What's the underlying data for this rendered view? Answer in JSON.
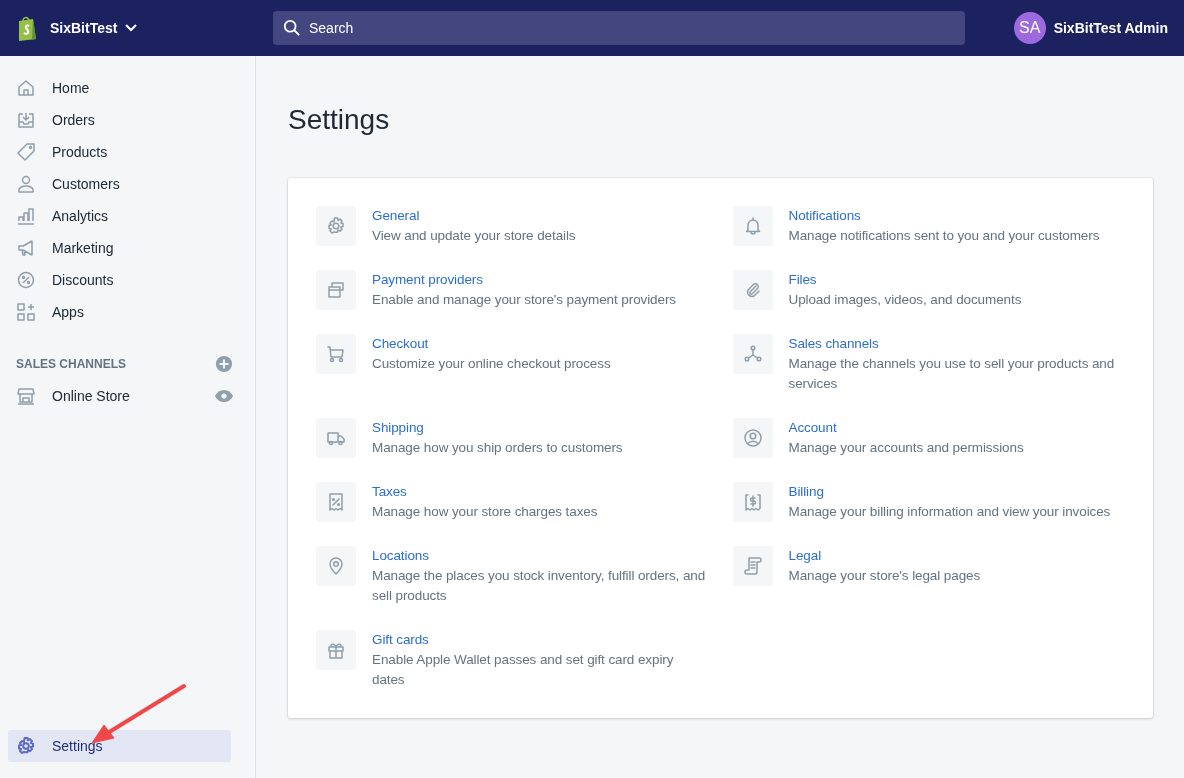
{
  "topbar": {
    "store_name": "SixBitTest",
    "search": {
      "placeholder": "Search"
    },
    "avatar_initials": "SA",
    "user_name": "SixBitTest Admin"
  },
  "sidebar": {
    "items": [
      {
        "label": "Home",
        "selected": false
      },
      {
        "label": "Orders",
        "selected": false
      },
      {
        "label": "Products",
        "selected": false
      },
      {
        "label": "Customers",
        "selected": false
      },
      {
        "label": "Analytics",
        "selected": false
      },
      {
        "label": "Marketing",
        "selected": false
      },
      {
        "label": "Discounts",
        "selected": false
      },
      {
        "label": "Apps",
        "selected": false
      }
    ],
    "sales_channels_heading": "SALES CHANNELS",
    "channels": [
      {
        "label": "Online Store",
        "selected": false
      }
    ],
    "settings_item": {
      "label": "Settings",
      "selected": true
    }
  },
  "page": {
    "title": "Settings",
    "settings": [
      {
        "title": "General",
        "description": "View and update your store details"
      },
      {
        "title": "Notifications",
        "description": "Manage notifications sent to you and your customers"
      },
      {
        "title": "Payment providers",
        "description": "Enable and manage your store's payment providers"
      },
      {
        "title": "Files",
        "description": "Upload images, videos, and documents"
      },
      {
        "title": "Checkout",
        "description": "Customize your online checkout process"
      },
      {
        "title": "Sales channels",
        "description": "Manage the channels you use to sell your products and services"
      },
      {
        "title": "Shipping",
        "description": "Manage how you ship orders to customers"
      },
      {
        "title": "Account",
        "description": "Manage your accounts and permissions"
      },
      {
        "title": "Taxes",
        "description": "Manage how your store charges taxes"
      },
      {
        "title": "Billing",
        "description": "Manage your billing information and view your invoices"
      },
      {
        "title": "Locations",
        "description": "Manage the places you stock inventory, fulfill orders, and sell products"
      },
      {
        "title": "Legal",
        "description": "Manage your store's legal pages"
      },
      {
        "title": "Gift cards",
        "description": "Enable Apple Wallet passes and set gift card expiry dates"
      }
    ]
  }
}
